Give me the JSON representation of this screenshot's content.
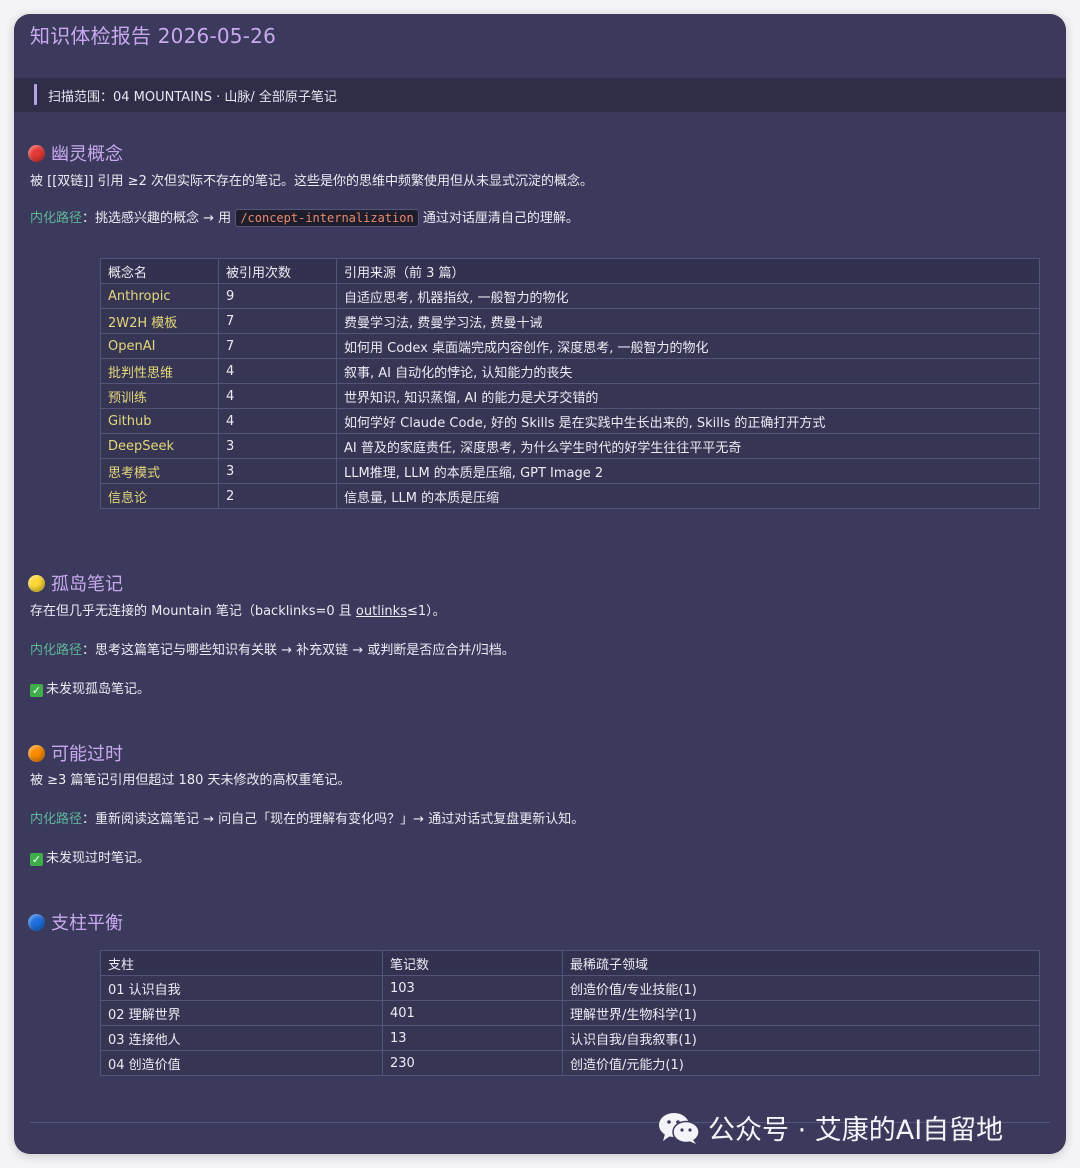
{
  "report": {
    "title": "知识体检报告 2026-05-26",
    "scope": "扫描范围：04 MOUNTAINS · 山脉/ 全部原子笔记"
  },
  "colors": {
    "accent": "#c8a9ee",
    "path_label": "#5fb59a",
    "concept": "#e3d87a",
    "code": "#e98a6a",
    "red": "#e53935",
    "yellow": "#fdd835",
    "orange": "#fb8c00",
    "blue": "#1e6fe0"
  },
  "ghost": {
    "icon": "red-circle-icon",
    "heading": "幽灵概念",
    "desc": "被 [[双链]] 引用 ≥2 次但实际不存在的笔记。这些是你的思维中频繁使用但从未显式沉淀的概念。",
    "path_label": "内化路径",
    "path_before": "：挑选感兴趣的概念 → 用 ",
    "path_code": "/concept-internalization",
    "path_after": " 通过对话厘清自己的理解。",
    "columns": [
      "概念名",
      "被引用次数",
      "引用来源（前 3 篇）"
    ],
    "rows": [
      {
        "name": "Anthropic",
        "count": "9",
        "sources": "自适应思考, 机器指纹, 一般智力的物化"
      },
      {
        "name": "2W2H 模板",
        "count": "7",
        "sources": "费曼学习法, 费曼学习法, 费曼十诫"
      },
      {
        "name": "OpenAI",
        "count": "7",
        "sources": "如何用 Codex 桌面端完成内容创作, 深度思考, 一般智力的物化"
      },
      {
        "name": "批判性思维",
        "count": "4",
        "sources": "叙事, AI 自动化的悖论, 认知能力的丧失"
      },
      {
        "name": "预训练",
        "count": "4",
        "sources": "世界知识, 知识蒸馏, AI 的能力是犬牙交错的"
      },
      {
        "name": "Github",
        "count": "4",
        "sources": "如何学好 Claude Code, 好的 Skills 是在实践中生长出来的, Skills 的正确打开方式"
      },
      {
        "name": "DeepSeek",
        "count": "3",
        "sources": "AI 普及的家庭责任, 深度思考, 为什么学生时代的好学生往往平平无奇"
      },
      {
        "name": "思考模式",
        "count": "3",
        "sources": "LLM推理, LLM 的本质是压缩, GPT Image 2"
      },
      {
        "name": "信息论",
        "count": "2",
        "sources": "信息量, LLM 的本质是压缩"
      }
    ]
  },
  "island": {
    "icon": "yellow-circle-icon",
    "heading": "孤岛笔记",
    "desc_before": "存在但几乎无连接的 Mountain 笔记（backlinks=0 且 ",
    "desc_link": "outlinks",
    "desc_after": "≤1）。",
    "path_label": "内化路径",
    "path_text": "：思考这篇笔记与哪些知识有关联 → 补充双链 → 或判断是否应合并/归档。",
    "result": "未发现孤岛笔记。"
  },
  "stale": {
    "icon": "orange-circle-icon",
    "heading": "可能过时",
    "desc": "被 ≥3 篇笔记引用但超过 180 天未修改的高权重笔记。",
    "path_label": "内化路径",
    "path_text": "：重新阅读这篇笔记 → 问自己「现在的理解有变化吗？」→ 通过对话式复盘更新认知。",
    "result": "未发现过时笔记。"
  },
  "pillar": {
    "icon": "blue-circle-icon",
    "heading": "支柱平衡",
    "columns": [
      "支柱",
      "笔记数",
      "最稀疏子领域"
    ],
    "rows": [
      {
        "name": "01 认识自我",
        "count": "103",
        "sparse": "创造价值/专业技能(1)"
      },
      {
        "name": "02 理解世界",
        "count": "401",
        "sparse": "理解世界/生物科学(1)"
      },
      {
        "name": "03 连接他人",
        "count": "13",
        "sparse": "认识自我/自我叙事(1)"
      },
      {
        "name": "04 创造价值",
        "count": "230",
        "sparse": "创造价值/元能力(1)"
      }
    ]
  },
  "watermark": {
    "icon": "wechat-icon",
    "text": "公众号 · 艾康的AI自留地"
  }
}
